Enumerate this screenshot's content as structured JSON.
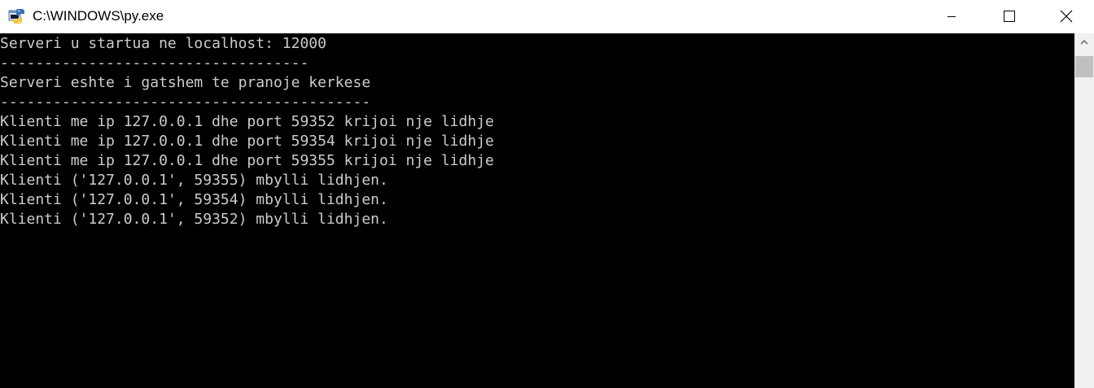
{
  "window": {
    "title": "C:\\WINDOWS\\py.exe",
    "icon": "python-launcher-icon"
  },
  "title_controls": {
    "minimize": "minimize-icon",
    "maximize": "maximize-icon",
    "close": "close-icon"
  },
  "console": {
    "lines": [
      "Serveri u startua ne localhost: 12000",
      "-----------------------------------",
      "Serveri eshte i gatshem te pranoje kerkese",
      "------------------------------------------",
      "Klienti me ip 127.0.0.1 dhe port 59352 krijoi nje lidhje",
      "Klienti me ip 127.0.0.1 dhe port 59354 krijoi nje lidhje",
      "Klienti me ip 127.0.0.1 dhe port 59355 krijoi nje lidhje",
      "Klienti ('127.0.0.1', 59355) mbylli lidhjen.",
      "Klienti ('127.0.0.1', 59354) mbylli lidhjen.",
      "Klienti ('127.0.0.1', 59352) mbylli lidhjen."
    ],
    "text_color": "#cccccc",
    "background": "#000000"
  },
  "scrollbar": {
    "up_arrow": "chevron-up-icon"
  }
}
